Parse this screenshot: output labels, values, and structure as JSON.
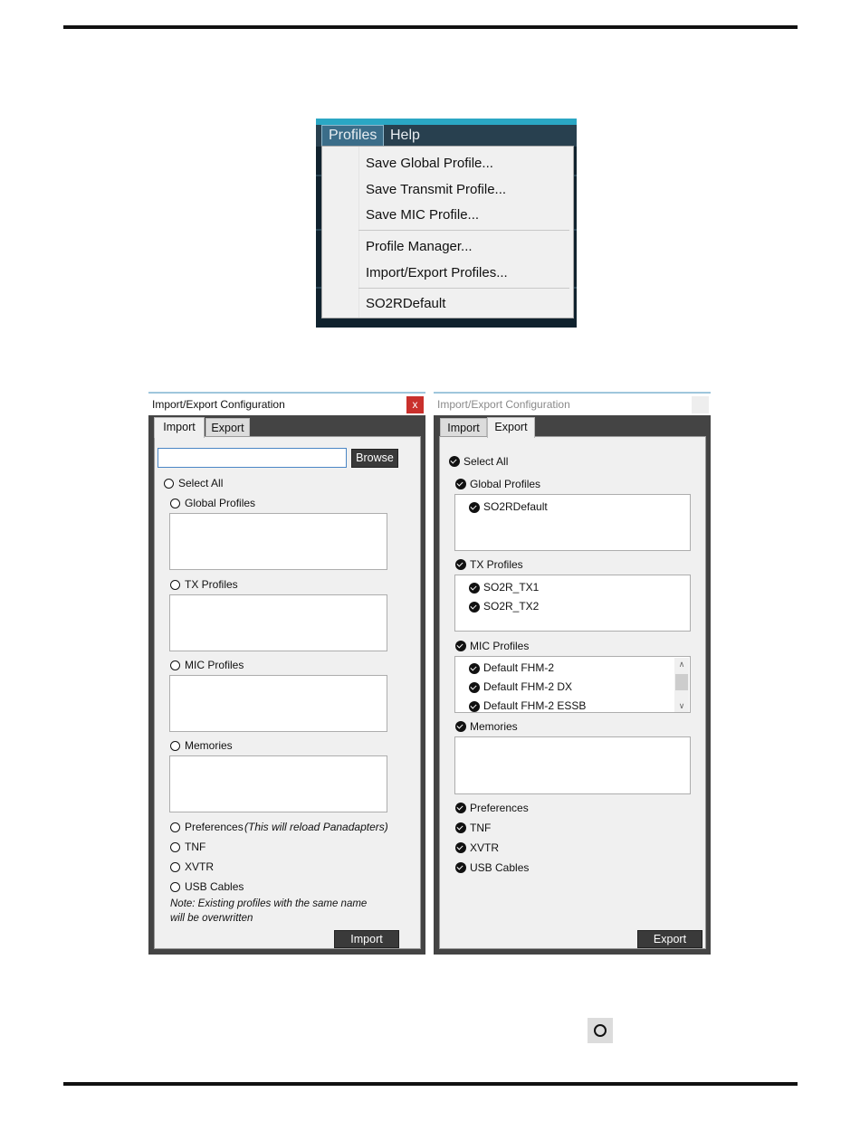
{
  "menu": {
    "bar": [
      "Profiles",
      "Help"
    ],
    "items": [
      "Save Global Profile...",
      "Save Transmit Profile...",
      "Save MIC Profile...",
      "Profile Manager...",
      "Import/Export Profiles...",
      "SO2RDefault"
    ]
  },
  "import_dialog": {
    "title": "Import/Export Configuration",
    "close": "x",
    "tabs": [
      "Import",
      "Export"
    ],
    "path_value": "",
    "browse": "Browse",
    "select_all": "Select All",
    "sections": [
      "Global Profiles",
      "TX Profiles",
      "MIC Profiles",
      "Memories"
    ],
    "preferences": "Preferences",
    "preferences_note": "(This will reload Panadapters)",
    "options": [
      "TNF",
      "XVTR",
      "USB Cables"
    ],
    "note_line1": "Note:  Existing profiles with the same name",
    "note_line2": "will be overwritten",
    "action": "Import"
  },
  "export_dialog": {
    "title": "Import/Export Configuration",
    "tabs": [
      "Import",
      "Export"
    ],
    "select_all": "Select All",
    "sections": [
      "Global Profiles",
      "TX Profiles",
      "MIC Profiles",
      "Memories"
    ],
    "global_profiles": [
      "SO2RDefault"
    ],
    "tx_profiles": [
      "SO2R_TX1",
      "SO2R_TX2"
    ],
    "mic_profiles": [
      "Default FHM-2",
      "Default FHM-2 DX",
      "Default FHM-2 ESSB"
    ],
    "options": [
      "Preferences",
      "TNF",
      "XVTR",
      "USB Cables"
    ],
    "action": "Export"
  },
  "icons": {
    "unchecked": "radio-circle-icon",
    "checked": "check-circle-icon",
    "close": "close-icon"
  },
  "colors": {
    "accent": "#2aa7c4",
    "close_button": "#c9302c",
    "dialog_frame": "#444444",
    "panel": "#f0f0f0"
  }
}
